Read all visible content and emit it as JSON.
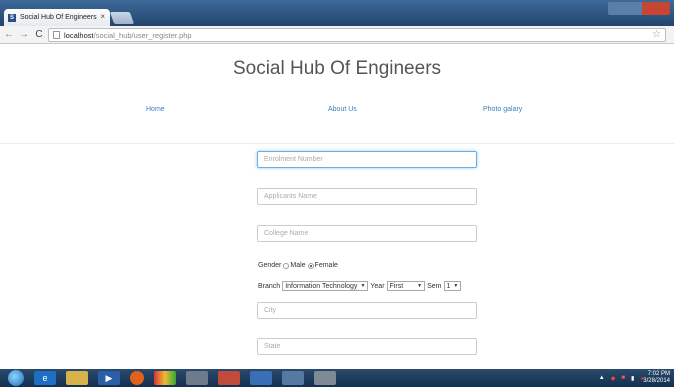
{
  "browser": {
    "tab_title": "Social Hub Of Engineers",
    "tab_close": "×",
    "favicon_letter": "S",
    "back": "←",
    "forward": "→",
    "reload": "C",
    "url_host": "localhost",
    "url_path": "/social_hub/user_register.php",
    "star": "☆"
  },
  "page": {
    "title": "Social Hub Of Engineers",
    "nav": {
      "home": "Home",
      "about": "About Us",
      "photo": "Photo galary"
    },
    "form": {
      "enrollment_placeholder": "Enrolment Number",
      "applicant_placeholder": "Applicants Name",
      "college_placeholder": "College Name",
      "gender_label": "Gender",
      "gender_male": "Male",
      "gender_female": "Female",
      "gender_selected": "Female",
      "branch_label": "Branch",
      "branch_value": "Information Technology",
      "year_label": "Year",
      "year_value": "First",
      "sem_label": "Sem",
      "sem_value": "1",
      "city_placeholder": "City",
      "state_placeholder": "State"
    }
  },
  "taskbar": {
    "time": "7:02 PM",
    "date": "3/28/2014"
  },
  "colors": {
    "link": "#3a7fc0",
    "focus_border": "#66afe9"
  }
}
